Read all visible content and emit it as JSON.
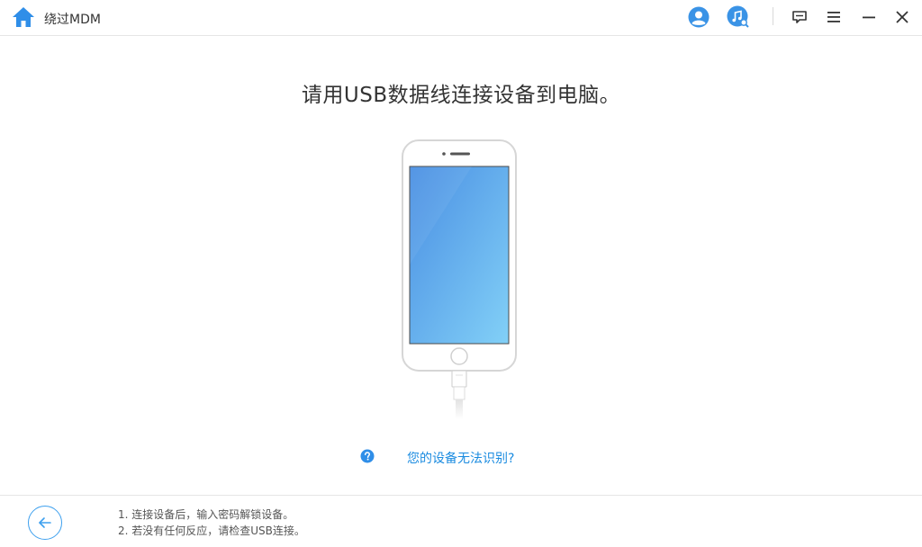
{
  "app": {
    "title": "绕过MDM"
  },
  "titlebar_icons": [
    "home-icon",
    "user-icon",
    "music-search-icon",
    "feedback-icon",
    "menu-icon",
    "minimize-icon",
    "close-icon"
  ],
  "main": {
    "heading": "请用USB数据线连接设备到电脑。",
    "help_link": "您的设备无法识别?"
  },
  "footer": {
    "tips": [
      "1. 连接设备后，输入密码解锁设备。",
      "2. 若没有任何反应，请检查USB连接。"
    ]
  },
  "colors": {
    "accent": "#3ea0ee",
    "link": "#1a8be0",
    "screen_top": "#4a90e2",
    "screen_bottom": "#7ecaf5"
  }
}
